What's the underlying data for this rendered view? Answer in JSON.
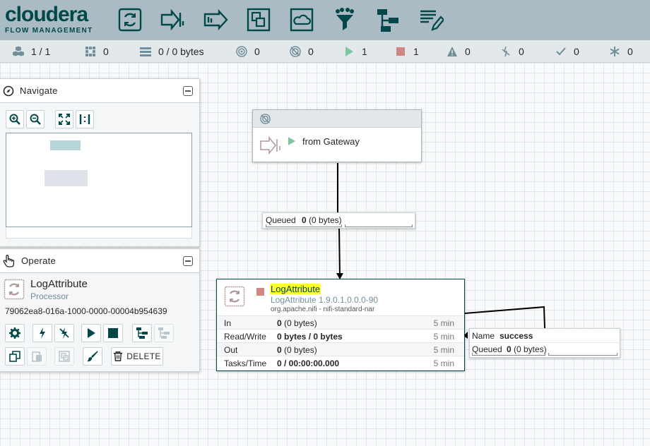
{
  "brand": {
    "name": "cloudera",
    "sub": "FLOW MANAGEMENT"
  },
  "toolbar": {
    "items": [
      "processor-icon",
      "input-port-icon",
      "output-port-icon",
      "process-group-icon",
      "remote-group-icon",
      "funnel-icon",
      "template-icon",
      "label-icon"
    ]
  },
  "status": {
    "nodes": "1 / 1",
    "threads": "0",
    "queued": "0 / 0 bytes",
    "transmitting": "0",
    "not_transmitting": "0",
    "running": "1",
    "stopped": "1",
    "invalid": "0",
    "disabled": "0",
    "up_to_date": "0",
    "locally_modified": "0"
  },
  "navigate": {
    "title": "Navigate"
  },
  "operate": {
    "title": "Operate",
    "component_name": "LogAttribute",
    "component_type": "Processor",
    "component_id": "79062ea8-016a-1000-0000-00004b954639",
    "delete_label": "DELETE"
  },
  "input_port": {
    "name": "from Gateway"
  },
  "connection1": {
    "queued_label": "Queued",
    "queued_count": "0",
    "queued_size": "(0 bytes)"
  },
  "processor": {
    "name": "LogAttribute",
    "version": "LogAttribute 1.9.0.1.0.0.0-90",
    "bundle": "org.apache.nifi - nifi-standard-nar",
    "rows": [
      {
        "label": "In",
        "count": "0",
        "size": "(0 bytes)",
        "window": "5 min"
      },
      {
        "label": "Read/Write",
        "count": "0 bytes / 0 bytes",
        "size": "",
        "window": "5 min"
      },
      {
        "label": "Out",
        "count": "0",
        "size": "(0 bytes)",
        "window": "5 min"
      },
      {
        "label": "Tasks/Time",
        "count": "0 / 00:00:00.000",
        "size": "",
        "window": "5 min"
      }
    ]
  },
  "connection2": {
    "name_label": "Name",
    "name_value": "success",
    "queued_label": "Queued",
    "queued_count": "0",
    "queued_size": "(0 bytes)"
  },
  "colors": {
    "header": "#aabbc3",
    "brand": "#004849",
    "running": "#7dc7a0",
    "stopped": "#d18686",
    "highlight": "#ffff33"
  }
}
